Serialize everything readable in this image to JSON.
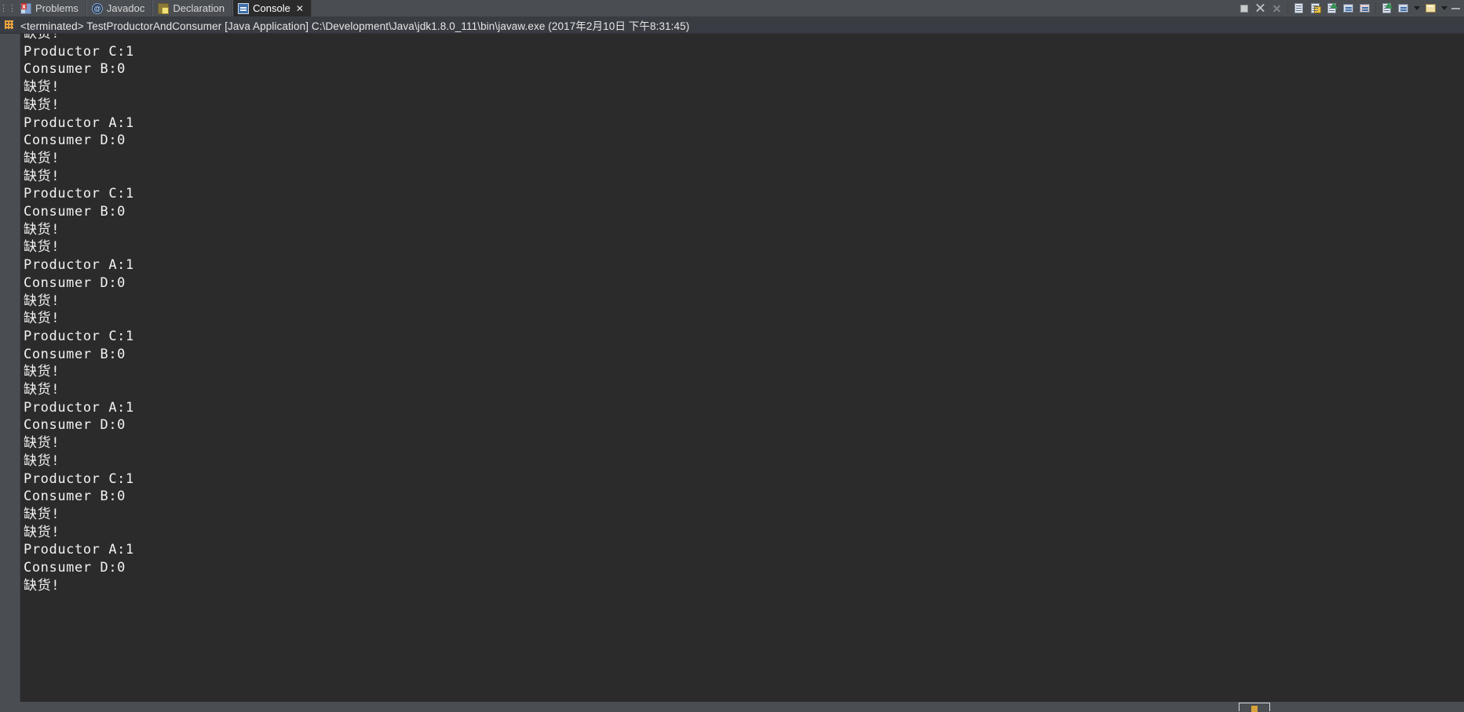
{
  "window": {
    "app": "Eclipse IDE",
    "view": "Console"
  },
  "tabbar": {
    "left_handle_icon": "drag-handle-icon",
    "tabs": [
      {
        "label": "Problems",
        "icon": "problems-icon",
        "active": false,
        "closable": false
      },
      {
        "label": "Javadoc",
        "icon": "javadoc-icon",
        "active": false,
        "closable": false
      },
      {
        "label": "Declaration",
        "icon": "declaration-icon",
        "active": false,
        "closable": false
      },
      {
        "label": "Console",
        "icon": "console-icon",
        "active": true,
        "closable": true
      }
    ],
    "close_glyph": "✕",
    "toolbar": [
      {
        "name": "terminate-button",
        "icon": "stop-square-icon"
      },
      {
        "name": "remove-launch-button",
        "icon": "remove-x-icon"
      },
      {
        "name": "remove-all-terminated-button",
        "icon": "remove-all-x-icon"
      },
      {
        "name": "clear-console-button",
        "icon": "clear-console-icon"
      },
      {
        "name": "scroll-lock-button",
        "icon": "scroll-lock-icon"
      },
      {
        "name": "word-wrap-button",
        "icon": "word-wrap-icon"
      },
      {
        "name": "display-selected-console-button",
        "icon": "display-console-icon"
      },
      {
        "name": "pin-console-button",
        "icon": "pin-console-icon"
      },
      {
        "name": "open-console-button",
        "icon": "open-console-icon"
      },
      {
        "name": "open-console-dropdown",
        "icon": "chevron-down-icon"
      },
      {
        "name": "new-console-view-button",
        "icon": "new-console-icon"
      },
      {
        "name": "view-menu-dropdown",
        "icon": "chevron-down-icon"
      },
      {
        "name": "minimize-view-button",
        "icon": "minimize-icon"
      }
    ]
  },
  "process": {
    "icon": "java-process-icon",
    "status": "<terminated>",
    "name": "TestProductorAndConsumer",
    "type": "[Java Application]",
    "path": "C:\\Development\\Java\\jdk1.8.0_111\\bin\\javaw.exe",
    "timestamp": "(2017年2月10日 下午8:31:45)",
    "full_line": "<terminated> TestProductorAndConsumer [Java Application] C:\\Development\\Java\\jdk1.8.0_111\\bin\\javaw.exe (2017年2月10日 下午8:31:45)"
  },
  "console": {
    "background_color": "#2b2b2b",
    "text_color": "#f2f2f2",
    "lines": [
      "缺货!",
      "Productor C:1",
      "Consumer B:0",
      "缺货!",
      "缺货!",
      "Productor A:1",
      "Consumer D:0",
      "缺货!",
      "缺货!",
      "Productor C:1",
      "Consumer B:0",
      "缺货!",
      "缺货!",
      "Productor A:1",
      "Consumer D:0",
      "缺货!",
      "缺货!",
      "Productor C:1",
      "Consumer B:0",
      "缺货!",
      "缺货!",
      "Productor A:1",
      "Consumer D:0",
      "缺货!",
      "缺货!",
      "Productor C:1",
      "Consumer B:0",
      "缺货!",
      "缺货!",
      "Productor A:1",
      "Consumer D:0",
      "缺货!"
    ]
  },
  "taskbar": {
    "peek_icon": "taskbar-window-icon"
  }
}
